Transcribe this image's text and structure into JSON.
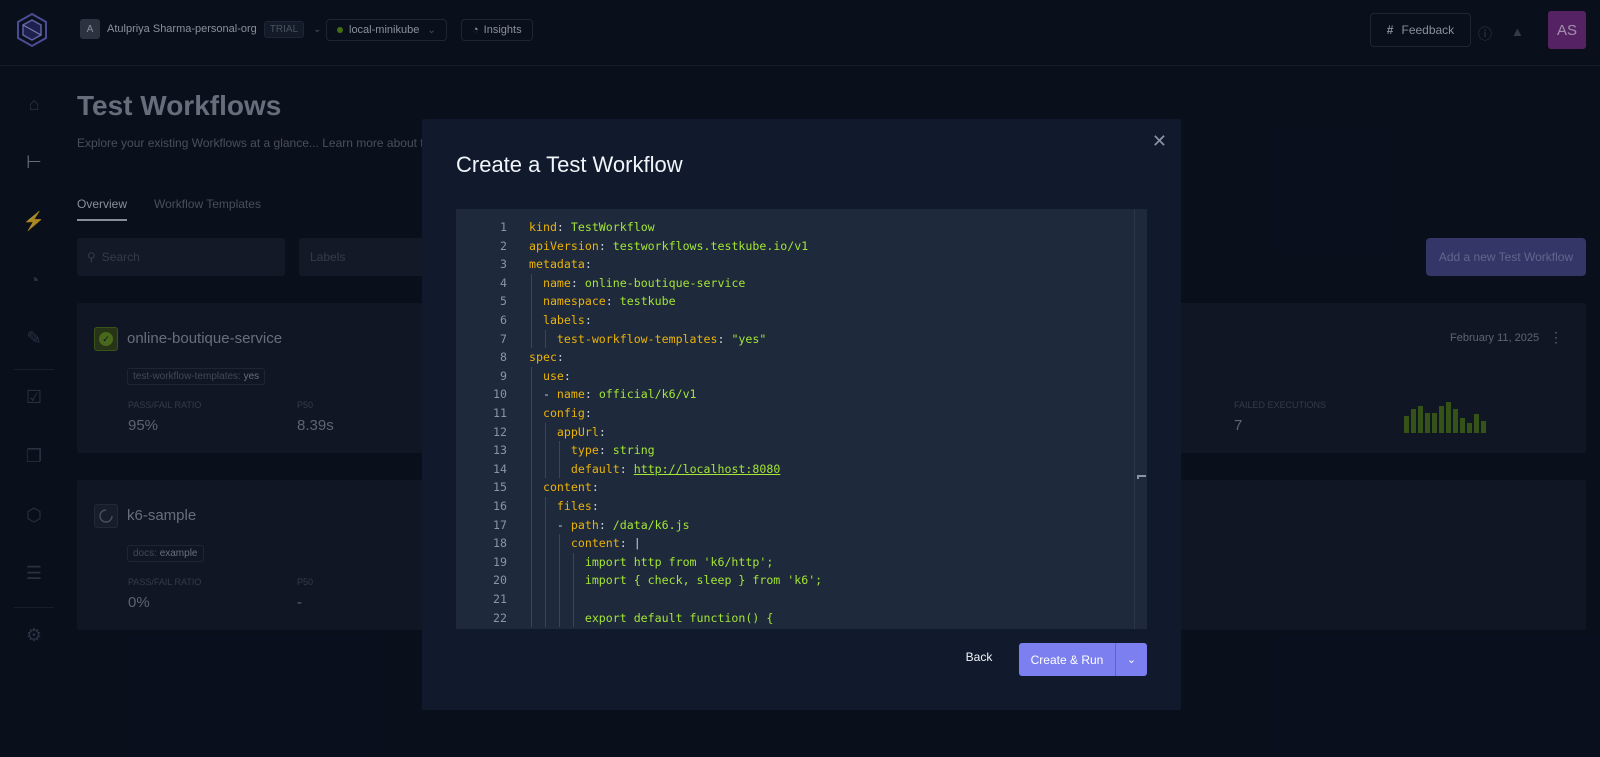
{
  "topbar": {
    "org_initial": "A",
    "org_name": "Atulpriya Sharma-personal-org",
    "trial": "TRIAL",
    "environment": "local-minikube",
    "insights": "Insights",
    "feedback": "Feedback",
    "user_initials": "AS",
    "colors": {
      "avatar": "#7e2f8e",
      "env_dot": "#65a30d"
    }
  },
  "sidebar": {
    "icons": [
      "home-icon",
      "workflows-icon",
      "triggers-icon",
      "analytics-icon",
      "clipboard-icon",
      "test-icon",
      "test-suite-icon",
      "shield-icon",
      "executors-icon",
      "settings-icon"
    ]
  },
  "page": {
    "title": "Test Workflows",
    "subtitle": "Explore your existing Workflows at a glance... Learn more about te",
    "tabs": [
      {
        "label": "Overview",
        "active": true
      },
      {
        "label": "Workflow Templates",
        "active": false
      }
    ],
    "search_placeholder": "Search",
    "labels_placeholder": "Labels",
    "add_button": "Add a new Test Workflow"
  },
  "workflows": [
    {
      "name": "online-boutique-service",
      "status": "passed",
      "tag_key": "test-workflow-templates:",
      "tag_value": "yes",
      "pass_fail_label": "PASS/FAIL RATIO",
      "pass_fail": "95%",
      "p50_label": "P50",
      "p50": "8.39s",
      "failed_label": "FAILED EXECUTIONS",
      "failed": "7",
      "date": "February 11, 2025",
      "execution_bars": [
        0.5,
        0.7,
        0.8,
        0.6,
        0.6,
        0.8,
        0.9,
        0.7,
        0.45,
        0.3,
        0.55,
        0.35
      ]
    },
    {
      "name": "k6-sample",
      "status": "pending",
      "tag_key": "docs:",
      "tag_value": "example",
      "pass_fail_label": "PASS/FAIL RATIO",
      "pass_fail": "0%",
      "p50_label": "P50",
      "p50": "-"
    }
  ],
  "modal": {
    "title": "Create a Test Workflow",
    "back": "Back",
    "create_run": "Create & Run",
    "code": [
      {
        "n": "1",
        "parts": [
          [
            "k",
            "kind"
          ],
          [
            "p",
            ": "
          ],
          [
            "s",
            "TestWorkflow"
          ]
        ]
      },
      {
        "n": "2",
        "parts": [
          [
            "k",
            "apiVersion"
          ],
          [
            "p",
            ": "
          ],
          [
            "s",
            "testworkflows.testkube.io/v1"
          ]
        ]
      },
      {
        "n": "3",
        "parts": [
          [
            "k",
            "metadata"
          ],
          [
            "p",
            ":"
          ]
        ]
      },
      {
        "n": "4",
        "parts": [
          [
            "p",
            "  "
          ],
          [
            "k",
            "name"
          ],
          [
            "p",
            ": "
          ],
          [
            "s",
            "online-boutique-service"
          ]
        ]
      },
      {
        "n": "5",
        "parts": [
          [
            "p",
            "  "
          ],
          [
            "k",
            "namespace"
          ],
          [
            "p",
            ": "
          ],
          [
            "s",
            "testkube"
          ]
        ]
      },
      {
        "n": "6",
        "parts": [
          [
            "p",
            "  "
          ],
          [
            "k",
            "labels"
          ],
          [
            "p",
            ":"
          ]
        ]
      },
      {
        "n": "7",
        "parts": [
          [
            "p",
            "    "
          ],
          [
            "k",
            "test-workflow-templates"
          ],
          [
            "p",
            ": "
          ],
          [
            "s",
            "\"yes\""
          ]
        ]
      },
      {
        "n": "8",
        "parts": [
          [
            "k",
            "spec"
          ],
          [
            "p",
            ":"
          ]
        ]
      },
      {
        "n": "9",
        "parts": [
          [
            "p",
            "  "
          ],
          [
            "k",
            "use"
          ],
          [
            "p",
            ":"
          ]
        ]
      },
      {
        "n": "10",
        "parts": [
          [
            "p",
            "  - "
          ],
          [
            "k",
            "name"
          ],
          [
            "p",
            ": "
          ],
          [
            "s",
            "official/k6/v1"
          ]
        ]
      },
      {
        "n": "11",
        "parts": [
          [
            "p",
            "  "
          ],
          [
            "k",
            "config"
          ],
          [
            "p",
            ":"
          ]
        ]
      },
      {
        "n": "12",
        "parts": [
          [
            "p",
            "    "
          ],
          [
            "k",
            "appUrl"
          ],
          [
            "p",
            ":"
          ]
        ]
      },
      {
        "n": "13",
        "parts": [
          [
            "p",
            "      "
          ],
          [
            "k",
            "type"
          ],
          [
            "p",
            ": "
          ],
          [
            "s",
            "string"
          ]
        ]
      },
      {
        "n": "14",
        "parts": [
          [
            "p",
            "      "
          ],
          [
            "k",
            "default"
          ],
          [
            "p",
            ": "
          ],
          [
            "u",
            "http://localhost:8080"
          ]
        ]
      },
      {
        "n": "15",
        "parts": [
          [
            "p",
            "  "
          ],
          [
            "k",
            "content"
          ],
          [
            "p",
            ":"
          ]
        ]
      },
      {
        "n": "16",
        "parts": [
          [
            "p",
            "    "
          ],
          [
            "k",
            "files"
          ],
          [
            "p",
            ":"
          ]
        ]
      },
      {
        "n": "17",
        "parts": [
          [
            "p",
            "    - "
          ],
          [
            "k",
            "path"
          ],
          [
            "p",
            ": "
          ],
          [
            "s",
            "/data/k6.js"
          ]
        ]
      },
      {
        "n": "18",
        "parts": [
          [
            "p",
            "      "
          ],
          [
            "k",
            "content"
          ],
          [
            "p",
            ": |"
          ]
        ]
      },
      {
        "n": "19",
        "parts": [
          [
            "p",
            "        "
          ],
          [
            "s",
            "import http from 'k6/http';"
          ]
        ]
      },
      {
        "n": "20",
        "parts": [
          [
            "p",
            "        "
          ],
          [
            "s",
            "import { check, sleep } from 'k6';"
          ]
        ]
      },
      {
        "n": "21",
        "parts": []
      },
      {
        "n": "22",
        "parts": [
          [
            "p",
            "        "
          ],
          [
            "s",
            "export default function() {"
          ]
        ]
      }
    ],
    "colors": {
      "key": "#eab308",
      "string": "#a3e635",
      "button": "#7c7ff0"
    }
  }
}
